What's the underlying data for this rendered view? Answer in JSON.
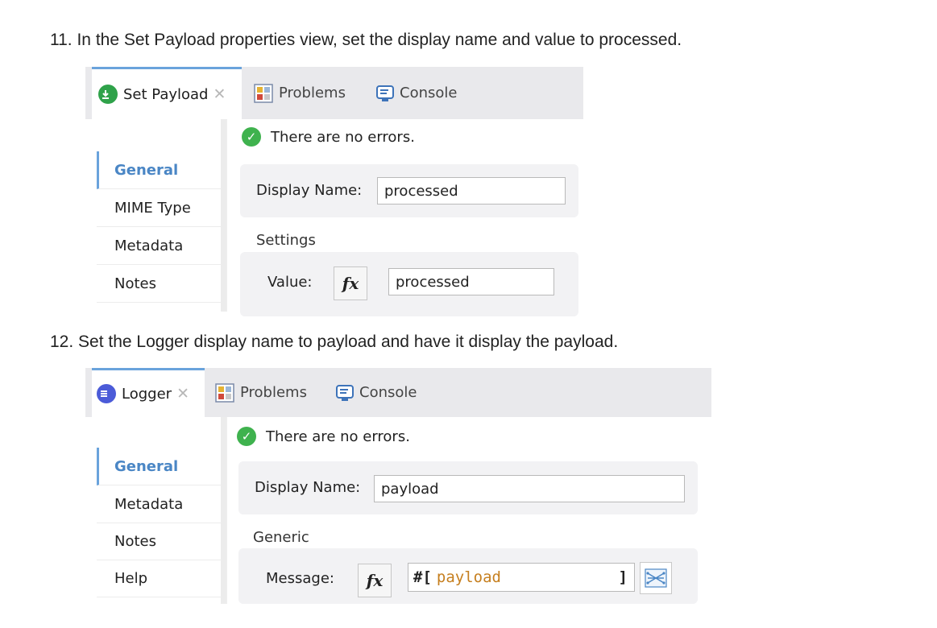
{
  "step1": {
    "text": "11. In the Set Payload properties view, set the display name and value to processed."
  },
  "step2": {
    "text": "12. Set the Logger display name to payload and have it display the payload."
  },
  "panel1": {
    "tabs": [
      {
        "label": "Set Payload",
        "icon": "set-payload-icon",
        "color": "#2fa24a",
        "active": true
      },
      {
        "label": "Problems",
        "icon": "problems-icon"
      },
      {
        "label": "Console",
        "icon": "console-icon"
      }
    ],
    "status": "There are no errors.",
    "sidebar": [
      "General",
      "MIME Type",
      "Metadata",
      "Notes"
    ],
    "display_name_label": "Display Name:",
    "display_name_value": "processed",
    "section": "Settings",
    "value_label": "Value:",
    "fx_label": "fx",
    "value_value": "processed"
  },
  "panel2": {
    "tabs": [
      {
        "label": "Logger",
        "icon": "logger-icon",
        "color": "#4b5bd8",
        "active": true
      },
      {
        "label": "Problems",
        "icon": "problems-icon"
      },
      {
        "label": "Console",
        "icon": "console-icon"
      }
    ],
    "status": "There are no errors.",
    "sidebar": [
      "General",
      "Metadata",
      "Notes",
      "Help"
    ],
    "display_name_label": "Display Name:",
    "display_name_value": "payload",
    "section": "Generic",
    "message_label": "Message:",
    "fx_label": "fx",
    "expr_prefix": "#[",
    "expr_keyword": "payload",
    "expr_suffix": "]"
  },
  "colors": {
    "accent": "#6aa3dc",
    "ok": "#3fb24e",
    "tabbar": "#e9e9ec",
    "keyword": "#c67f1f"
  }
}
